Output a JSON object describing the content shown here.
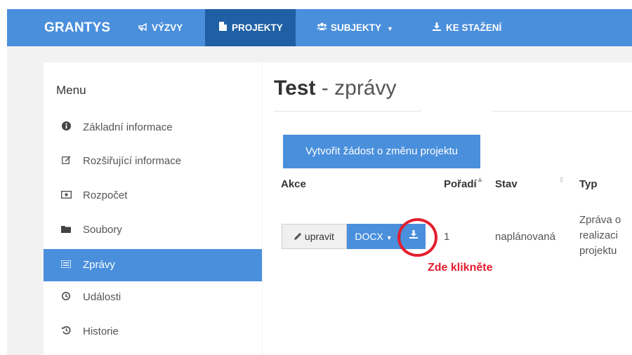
{
  "navbar": {
    "brand": "GRANTYS",
    "items": [
      {
        "label": "VÝZVY",
        "icon": "bullhorn-icon"
      },
      {
        "label": "PROJEKTY",
        "icon": "file-icon",
        "active": true
      },
      {
        "label": "SUBJEKTY",
        "icon": "users-icon"
      },
      {
        "label": "KE STAŽENÍ",
        "icon": "download-icon"
      }
    ]
  },
  "sidebar": {
    "title": "Menu",
    "items": [
      {
        "label": "Základní informace",
        "icon": "info-circle-icon"
      },
      {
        "label": "Rozšiřující informace",
        "icon": "edit-icon"
      },
      {
        "label": "Rozpočet",
        "icon": "money-icon"
      },
      {
        "label": "Soubory",
        "icon": "folder-icon"
      },
      {
        "label": "Zprávy",
        "icon": "list-icon",
        "active": true
      },
      {
        "label": "Události",
        "icon": "clock-icon"
      },
      {
        "label": "Historie",
        "icon": "history-icon"
      }
    ]
  },
  "main": {
    "title_bold": "Test",
    "title_rest": " - zprávy",
    "change_request_button": "Vytvořit žádost o změnu projektu",
    "table": {
      "headers": [
        "Akce",
        "Pořadí",
        "Stav",
        "Typ"
      ],
      "rows": [
        {
          "edit_label": "upravit",
          "format_label": "DOCX",
          "order": "1",
          "state": "naplánovaná",
          "type_lines": [
            "Zpráva o",
            "realizaci",
            "projektu"
          ]
        }
      ]
    }
  },
  "annotation": {
    "text": "Zde klikněte",
    "color": "#e21e2e"
  },
  "colors": {
    "navbar": "#4a8fdc",
    "navbar_active": "#1f5fa4",
    "accent": "#4a8fdc"
  }
}
